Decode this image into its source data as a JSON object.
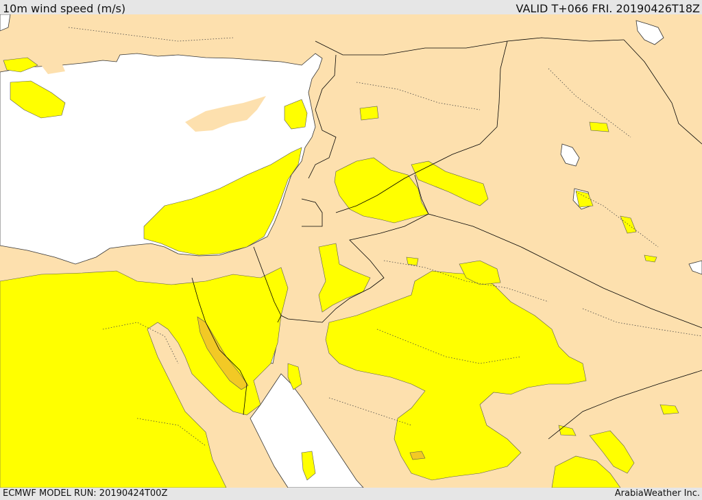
{
  "header": {
    "title": "10m wind speed (m/s)",
    "valid_time": "VALID T+066 FRI. 20190426T18Z"
  },
  "footer": {
    "model_run": "ECMWF MODEL RUN: 20190424T00Z",
    "credit": "ArabiaWeather Inc."
  },
  "colors": {
    "land": "#fde0ae",
    "sea": "#ffffff",
    "wind_band_1": "#ffff00",
    "wind_band_2": "#f2c925",
    "border": "#000000",
    "frame": "#e6e6e6"
  }
}
